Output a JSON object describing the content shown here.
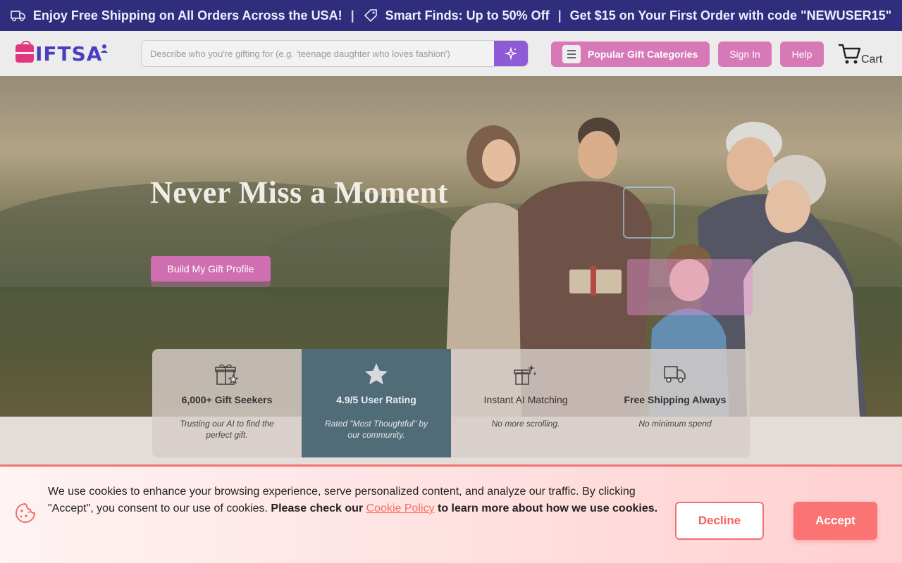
{
  "announcement": {
    "shipping": "Enjoy Free Shipping on All Orders Across the USA!",
    "sep": "|",
    "deals": "Smart Finds: Up to 50% Off",
    "promo": "Get $15 on Your First Order with code \"NEWUSER15\""
  },
  "header": {
    "logo_text": "IFTSA",
    "search_placeholder": "Describe who you're gifting for (e.g. 'teenage daughter who loves fashion')",
    "categories_label": "Popular Gift Categories",
    "signin_label": "Sign In",
    "help_label": "Help",
    "cart_label": "Cart"
  },
  "hero": {
    "title": "Never Miss a Moment",
    "cta_label": "Build My Gift Profile"
  },
  "stats": [
    {
      "icon": "gift-star-icon",
      "title": "6,000+ Gift Seekers",
      "desc": "Trusting our AI to find the perfect gift."
    },
    {
      "icon": "star-icon",
      "title": "4.9/5 User Rating",
      "desc": "Rated \"Most Thoughtful\" by our community."
    },
    {
      "icon": "sparkle-gift-icon",
      "title": "Instant AI Matching",
      "desc": "No more scrolling."
    },
    {
      "icon": "truck-icon",
      "title": "Free Shipping Always",
      "desc": "No minimum spend"
    }
  ],
  "cookie": {
    "text_1": "We use cookies to enhance your browsing experience, serve personalized content, and analyze our traffic. By clicking \"Accept\", you consent to our use of cookies. ",
    "text_bold_1": "Please check our ",
    "link": "Cookie Policy",
    "text_bold_2": " to learn more about how we use cookies.",
    "decline_label": "Decline",
    "accept_label": "Accept"
  },
  "colors": {
    "announcement_bg": "#302d7c",
    "brand_pink": "#d779b7",
    "brand_purple": "#4a3fbe",
    "cookie_accent": "#fa7474",
    "active_stat": "#4f6c78"
  }
}
